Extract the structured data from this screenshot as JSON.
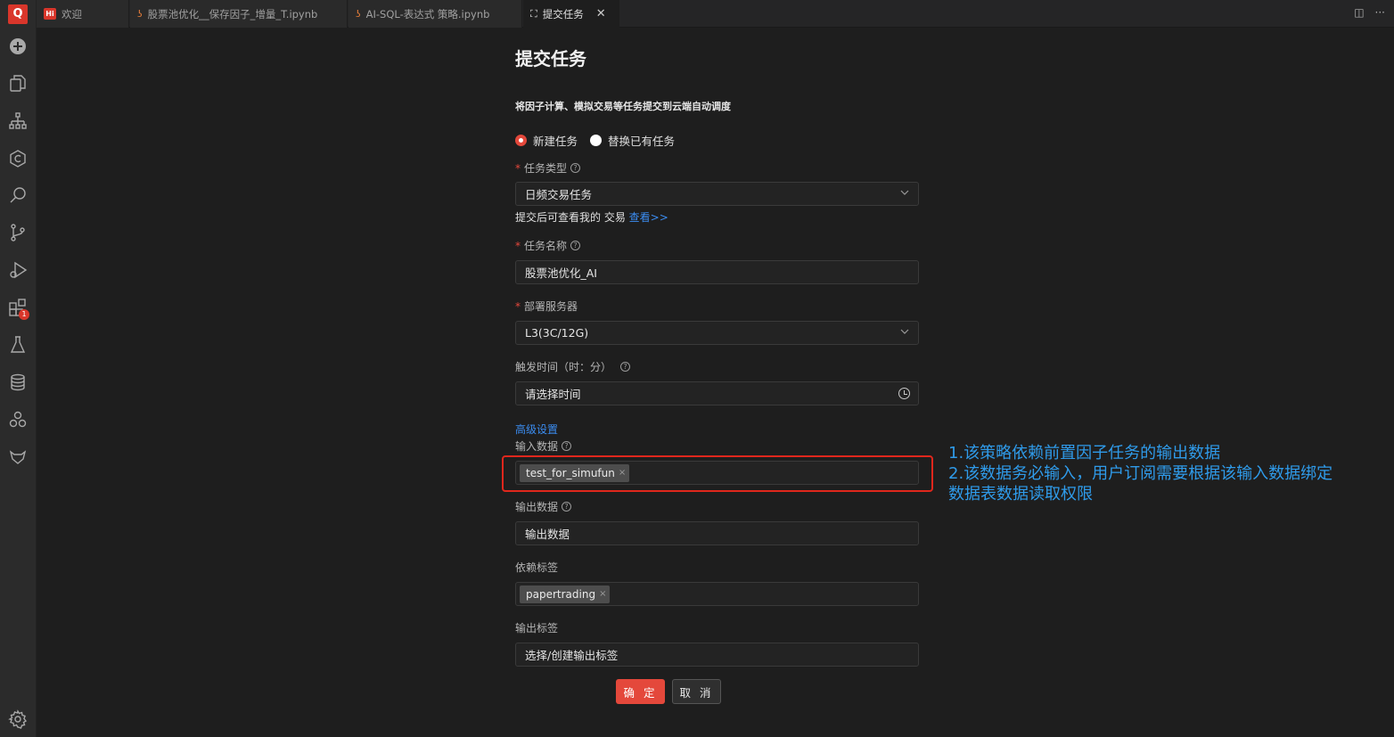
{
  "app": {
    "logo": "Q"
  },
  "activity_bar": {
    "icons": [
      "add-icon",
      "files-icon",
      "hierarchy-icon",
      "hexagon-icon",
      "search-icon",
      "source-control-icon",
      "run-debug-icon",
      "extensions-icon",
      "flask-icon",
      "database-icon",
      "cluster-icon",
      "gitlab-icon",
      "settings-icon"
    ],
    "extensions_badge": "1"
  },
  "tabs": [
    {
      "icon": "Hi",
      "label": "欢迎",
      "active": false
    },
    {
      "icon": "jupyter-icon",
      "label": "股票池优化__保存因子_增量_T.ipynb",
      "active": false
    },
    {
      "icon": "jupyter-icon",
      "label": "AI-SQL-表达式 策略.ipynb",
      "active": false
    },
    {
      "icon": "hierarchy-icon",
      "label": "提交任务",
      "active": true,
      "close": "✕"
    }
  ],
  "tabbar_right": {
    "split": "◫",
    "more": "···"
  },
  "form": {
    "title": "提交任务",
    "subtitle": "将因子计算、模拟交易等任务提交到云端自动调度",
    "radio_new": "新建任务",
    "radio_replace": "替换已有任务",
    "task_type_label": "任务类型",
    "task_type_value": "日频交易任务",
    "hint_text": "提交后可查看我的 交易 ",
    "hint_link": "查看>>",
    "task_name_label": "任务名称",
    "task_name_value": "股票池优化_AI",
    "server_label": "部署服务器",
    "server_value": "L3(3C/12G)",
    "trigger_label": "触发时间（时：分）",
    "trigger_placeholder": "请选择时间",
    "advanced_label": "高级设置",
    "input_data_label": "输入数据",
    "input_data_tag": "test_for_simufun",
    "output_data_label": "输出数据",
    "output_data_placeholder": "输出数据",
    "dep_tags_label": "依赖标签",
    "dep_tag": "papertrading",
    "output_tags_label": "输出标签",
    "output_tags_placeholder": "选择/创建输出标签",
    "ok_label": "确 定",
    "cancel_label": "取 消",
    "tag_remove": "×",
    "required_mark": "*",
    "help_mark": "?"
  },
  "annotation": {
    "line1": "1.该策略依赖前置因子任务的输出数据",
    "line2": "2.该数据务必输入，用户订阅需要根据该输入数据绑定",
    "line3": "数据表数据读取权限"
  },
  "colors": {
    "accent": "#e4483b",
    "link": "#3b8cf0",
    "annotation": "#2f9bea",
    "background": "#1e1e1e"
  }
}
